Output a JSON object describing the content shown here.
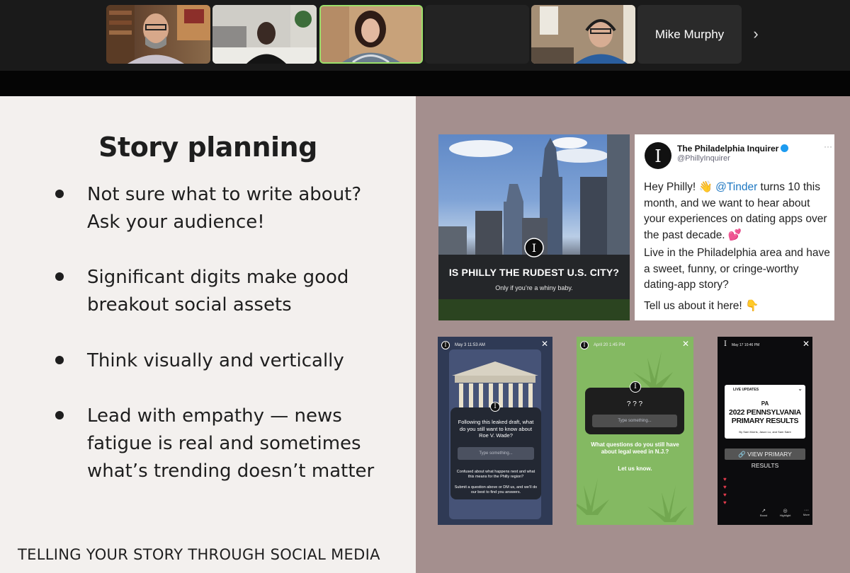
{
  "zoom": {
    "participants": [
      {
        "kind": "video"
      },
      {
        "kind": "video"
      },
      {
        "kind": "video",
        "active": true
      },
      {
        "kind": "video"
      },
      {
        "kind": "video"
      },
      {
        "kind": "name",
        "name": "Mike Murphy"
      }
    ],
    "next_icon": "chevron-right-icon"
  },
  "slide": {
    "title": "Story planning",
    "bullets": [
      {
        "line1": "Not sure what to write about?",
        "line2": "Ask your audience!"
      },
      {
        "line1": "Significant digits make good",
        "line2": "breakout social assets"
      },
      {
        "line1": "Think visually and vertically"
      },
      {
        "line1": "Lead with empathy — news",
        "line2": "fatigue is real and sometimes",
        "line3": "what’s trending doesn’t matter"
      }
    ],
    "footer": "TELLING YOUR STORY THROUGH SOCIAL MEDIA"
  },
  "philly_post": {
    "headline": "IS PHILLY THE RUDEST U.S. CITY?",
    "subline": "Only if you’re a whiny baby."
  },
  "tweet": {
    "name": "The Philadelphia Inquirer",
    "handle": "@PhillyInquirer",
    "p1_before": "Hey Philly! 👋 ",
    "p1_mention": "@Tinder",
    "p1_after": " turns 10 this month, and we want to hear about your experiences on dating apps over the past decade. 💕",
    "p2": "Live in the Philadelphia area and have a sweet, funny, or cringe-worthy dating-app story?",
    "p3": "Tell us about it here! 👇"
  },
  "stories": {
    "s1": {
      "date": "May 3   11:53 AM",
      "question": "Following this leaked draft, what do you still want to know about Roe V. Wade?",
      "placeholder": "Type something...",
      "note1": "Confused about what happens next and what this means for the Philly region?",
      "note2": "Submit a question above or DM us, and we’ll do our best to find you answers."
    },
    "s2": {
      "date": "April 20   1:45 PM",
      "marks": "? ? ?",
      "placeholder": "Type something...",
      "question": "What questions do you still have about legal weed in N.J.?",
      "cta": "Let us know."
    },
    "s3": {
      "date": "May 17   10:46 PM",
      "badge": "LIVE UPDATES",
      "state": "PA",
      "title": "2022 PENNSYLVANIA PRIMARY RESULTS",
      "byline": "By Sam Morris, Jason Lo, and Sam Saint",
      "button": "🔗 VIEW PRIMARY RESULTS",
      "actions": [
        "Boost",
        "Highlight",
        "More"
      ]
    }
  }
}
